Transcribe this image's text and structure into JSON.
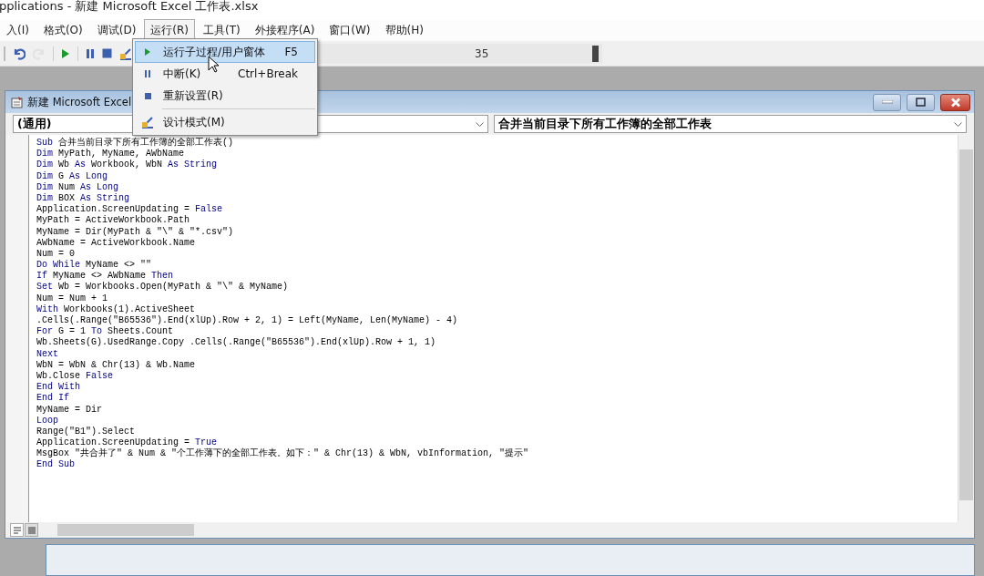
{
  "window": {
    "title": "pplications - 新建 Microsoft Excel 工作表.xlsx"
  },
  "menu_bar": [
    {
      "label": "入(I)",
      "selected": false
    },
    {
      "label": "格式(O)",
      "selected": false
    },
    {
      "label": "调试(D)",
      "selected": false
    },
    {
      "label": "运行(R)",
      "selected": true
    },
    {
      "label": "工具(T)",
      "selected": false
    },
    {
      "label": "外接程序(A)",
      "selected": false
    },
    {
      "label": "窗口(W)",
      "selected": false
    },
    {
      "label": "帮助(H)",
      "selected": false
    }
  ],
  "toolbar": {
    "buttons": [
      {
        "kind": "undo",
        "disabled": false
      },
      {
        "kind": "redo",
        "disabled": true
      },
      {
        "kind": "run",
        "disabled": false
      },
      {
        "kind": "pause",
        "disabled": false
      },
      {
        "kind": "stop",
        "disabled": false
      },
      {
        "kind": "design",
        "disabled": false
      }
    ],
    "position_text": "35"
  },
  "run_menu": {
    "items": [
      {
        "kind": "run",
        "label": "运行子过程/用户窗体",
        "shortcut": "F5",
        "selected": true
      },
      {
        "kind": "pause",
        "label": "中断(K)",
        "shortcut": "Ctrl+Break",
        "selected": false
      },
      {
        "kind": "stop",
        "label": "重新设置(R)",
        "selected": false
      },
      {
        "kind": "design",
        "label": "设计模式(M)",
        "selected": false
      }
    ]
  },
  "code_window": {
    "title": "新建 Microsoft Excel",
    "object_box": "(通用)",
    "procedure_box": "合并当前目录下所有工作簿的全部工作表",
    "lines": [
      [
        {
          "t": "Sub",
          "k": true
        },
        {
          "t": " 合并当前目录下所有工作簿的全部工作表()",
          "k": false
        }
      ],
      [
        {
          "t": "Dim",
          "k": true
        },
        {
          "t": " MyPath, MyName, AWbName",
          "k": false
        }
      ],
      [
        {
          "t": "Dim",
          "k": true
        },
        {
          "t": " Wb ",
          "k": false
        },
        {
          "t": "As",
          "k": true
        },
        {
          "t": " Workbook, WbN ",
          "k": false
        },
        {
          "t": "As String",
          "k": true
        }
      ],
      [
        {
          "t": "Dim",
          "k": true
        },
        {
          "t": " G ",
          "k": false
        },
        {
          "t": "As Long",
          "k": true
        }
      ],
      [
        {
          "t": "Dim",
          "k": true
        },
        {
          "t": " Num ",
          "k": false
        },
        {
          "t": "As Long",
          "k": true
        }
      ],
      [
        {
          "t": "Dim",
          "k": true
        },
        {
          "t": " BOX ",
          "k": false
        },
        {
          "t": "As String",
          "k": true
        }
      ],
      [
        {
          "t": "Application.ScreenUpdating = ",
          "k": false
        },
        {
          "t": "False",
          "k": true
        }
      ],
      [
        {
          "t": "MyPath = ActiveWorkbook.Path",
          "k": false
        }
      ],
      [
        {
          "t": "MyName = Dir(MyPath & \"\\\" & \"*.csv\")",
          "k": false
        }
      ],
      [
        {
          "t": "AWbName = ActiveWorkbook.Name",
          "k": false
        }
      ],
      [
        {
          "t": "Num = 0",
          "k": false
        }
      ],
      [
        {
          "t": "Do While",
          "k": true
        },
        {
          "t": " MyName <> \"\"",
          "k": false
        }
      ],
      [
        {
          "t": "If",
          "k": true
        },
        {
          "t": " MyName <> AWbName ",
          "k": false
        },
        {
          "t": "Then",
          "k": true
        }
      ],
      [
        {
          "t": "Set",
          "k": true
        },
        {
          "t": " Wb = Workbooks.Open(MyPath & \"\\\" & MyName)",
          "k": false
        }
      ],
      [
        {
          "t": "Num = Num + 1",
          "k": false
        }
      ],
      [
        {
          "t": "With",
          "k": true
        },
        {
          "t": " Workbooks(1).ActiveSheet",
          "k": false
        }
      ],
      [
        {
          "t": ".Cells(.Range(\"B65536\").End(xlUp).Row + 2, 1) = Left(MyName, Len(MyName) - 4)",
          "k": false
        }
      ],
      [
        {
          "t": "For",
          "k": true
        },
        {
          "t": " G = 1 ",
          "k": false
        },
        {
          "t": "To",
          "k": true
        },
        {
          "t": " Sheets.Count",
          "k": false
        }
      ],
      [
        {
          "t": "Wb.Sheets(G).UsedRange.Copy .Cells(.Range(\"B65536\").End(xlUp).Row + 1, 1)",
          "k": false
        }
      ],
      [
        {
          "t": "Next",
          "k": true
        }
      ],
      [
        {
          "t": "WbN = WbN & Chr(13) & Wb.Name",
          "k": false
        }
      ],
      [
        {
          "t": "Wb.Close ",
          "k": false
        },
        {
          "t": "False",
          "k": true
        }
      ],
      [
        {
          "t": "End With",
          "k": true
        }
      ],
      [
        {
          "t": "End If",
          "k": true
        }
      ],
      [
        {
          "t": "MyName = Dir",
          "k": false
        }
      ],
      [
        {
          "t": "Loop",
          "k": true
        }
      ],
      [
        {
          "t": "Range(\"B1\").Select",
          "k": false
        }
      ],
      [
        {
          "t": "Application.ScreenUpdating = ",
          "k": false
        },
        {
          "t": "True",
          "k": true
        }
      ],
      [
        {
          "t": "MsgBox \"共合并了\" & Num & \"个工作薄下的全部工作表。如下：\" & Chr(13) & WbN, vbInformation, \"提示\"",
          "k": false
        }
      ],
      [
        {
          "t": "End Sub",
          "k": true
        }
      ]
    ]
  }
}
